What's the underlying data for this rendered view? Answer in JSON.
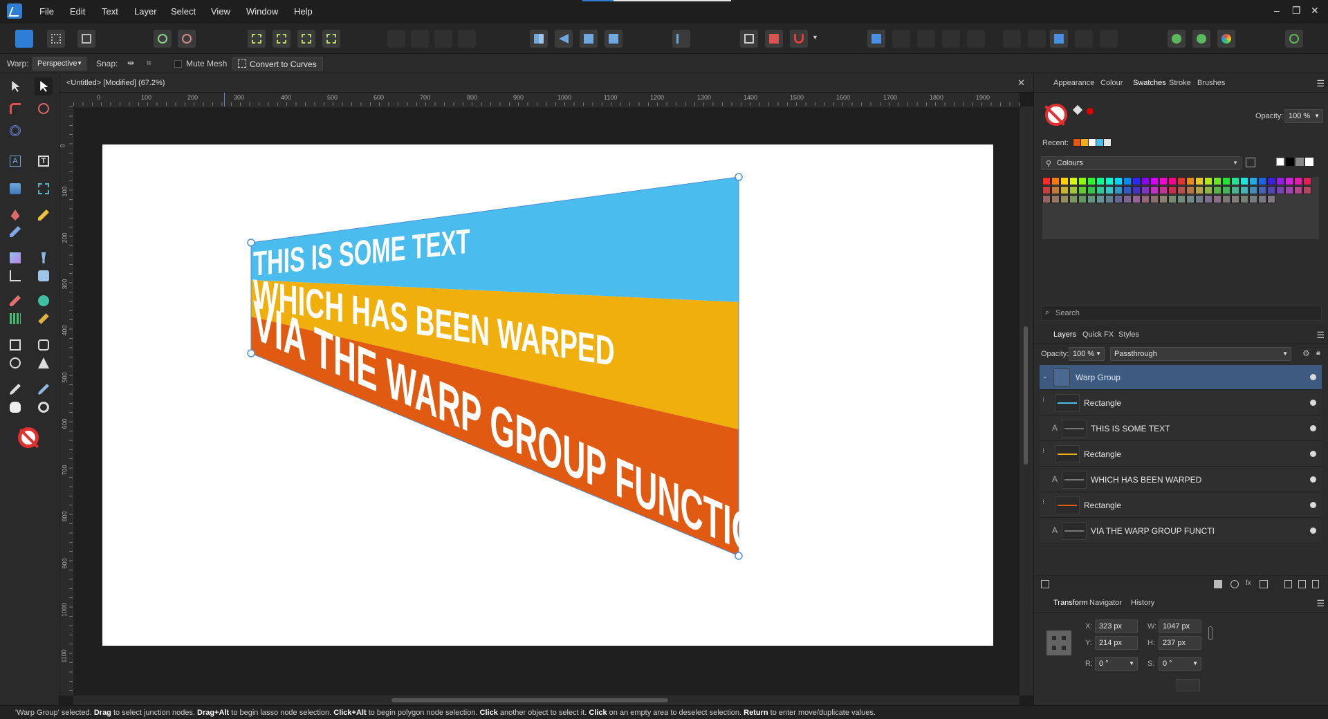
{
  "menubar": {
    "items": [
      "File",
      "Edit",
      "Text",
      "Layer",
      "Select",
      "View",
      "Window",
      "Help"
    ],
    "window_controls": [
      "–",
      "❐",
      "✕"
    ]
  },
  "context_bar": {
    "warp_label": "Warp:",
    "warp_value": "Perspective",
    "snap_label": "Snap:",
    "mute_mesh_label": "Mute Mesh",
    "convert_button": "Convert to Curves"
  },
  "document": {
    "tab_title": "<Untitled> [Modified] (67.2%)",
    "close_glyph": "✕",
    "hruler_ticks": [
      "0",
      "100",
      "200",
      "300",
      "400",
      "500",
      "600",
      "700",
      "800",
      "900",
      "1000",
      "1100",
      "1200",
      "1300",
      "1400",
      "1500",
      "1600",
      "1700",
      "1800",
      "1900"
    ],
    "vruler_ticks": [
      "0",
      "100",
      "200",
      "300",
      "400",
      "500",
      "600",
      "700",
      "800",
      "900",
      "1000",
      "1100"
    ],
    "artwork": {
      "band1_text": "THIS IS SOME TEXT",
      "band2_text": "WHICH HAS BEEN WARPED",
      "band3_text": "VIA THE WARP GROUP FUNCTION",
      "colors": {
        "band1": "#4bbcee",
        "band2": "#f1af0c",
        "band3": "#e05a12",
        "text": "#ffffff",
        "handle": "#4d8fd6"
      }
    }
  },
  "panel_top": {
    "tabs": [
      "Appearance",
      "Colour",
      "Swatches",
      "Stroke",
      "Brushes"
    ],
    "active_tab": "Swatches",
    "opacity_label": "Opacity:",
    "opacity_value": "100 %",
    "recent_label": "Recent:",
    "recent_colors": [
      "#e05a12",
      "#f1af0c",
      "#ffffff",
      "#4bbcee",
      "#e6e6e6"
    ],
    "palette_label": "Colours",
    "palette_colors": [
      "#ff2a2a",
      "#ff7a00",
      "#ffd400",
      "#d6ff00",
      "#8cff00",
      "#2aff2a",
      "#00ff8c",
      "#00ffd6",
      "#00d6ff",
      "#008cff",
      "#2a2aff",
      "#8c00ff",
      "#d600ff",
      "#ff00d6",
      "#ff008c",
      "#e63232",
      "#e68a1e",
      "#e6c81e",
      "#b4e61e",
      "#6ee61e",
      "#1ee632",
      "#1ee696",
      "#1ee6dc",
      "#1eaae6",
      "#1e64e6",
      "#3c1ee6",
      "#961ee6",
      "#dc1ee6",
      "#e61eaa",
      "#e61e5a",
      "#c83c3c",
      "#c87a32",
      "#c8b432",
      "#a0c832",
      "#64c832",
      "#32c846",
      "#32c896",
      "#32c8c8",
      "#3296c8",
      "#325ac8",
      "#4632c8",
      "#8232c8",
      "#c032c8",
      "#c83296",
      "#c83250",
      "#b45050",
      "#b47846",
      "#b4a046",
      "#8cb446",
      "#5ab446",
      "#46b45a",
      "#46b48c",
      "#46b4b4",
      "#468cb4",
      "#4664b4",
      "#5046b4",
      "#7846b4",
      "#a046b4",
      "#b4468c",
      "#b44660",
      "#966464",
      "#967864",
      "#968c64",
      "#7d9664",
      "#649664",
      "#64967d",
      "#649696",
      "#647d96",
      "#646496",
      "#7d6496",
      "#966496",
      "#96647d",
      "#8c7070",
      "#8c8270",
      "#7a8c70",
      "#708c7a",
      "#708a8c",
      "#707a8c",
      "#7a708c",
      "#8c7088",
      "#807878",
      "#808078",
      "#788078",
      "#787e80",
      "#787880",
      "#807880"
    ],
    "search_placeholder": "Search"
  },
  "layers_panel": {
    "tabs": [
      "Layers",
      "Quick FX",
      "Styles"
    ],
    "active_tab": "Layers",
    "opacity_label": "Opacity:",
    "opacity_value": "100 %",
    "blend_mode": "Passthrough",
    "rows": [
      {
        "name": "Warp Group",
        "type": "group"
      },
      {
        "name": "Rectangle",
        "type": "rect",
        "color": "#4bbcee"
      },
      {
        "name": "THIS IS SOME TEXT",
        "type": "text"
      },
      {
        "name": "Rectangle",
        "type": "rect",
        "color": "#f1af0c"
      },
      {
        "name": "WHICH HAS BEEN WARPED",
        "type": "text"
      },
      {
        "name": "Rectangle",
        "type": "rect",
        "color": "#e05a12"
      },
      {
        "name": "VIA THE WARP GROUP FUNCTI",
        "type": "text"
      }
    ]
  },
  "transform_panel": {
    "tabs": [
      "Transform",
      "Navigator",
      "History"
    ],
    "active_tab": "Transform",
    "x_label": "X:",
    "x_value": "323 px",
    "y_label": "Y:",
    "y_value": "214 px",
    "w_label": "W:",
    "w_value": "1047 px",
    "h_label": "H:",
    "h_value": "237 px",
    "r_label": "R:",
    "r_value": "0 °",
    "s_label": "S:",
    "s_value": "0 °"
  },
  "status": {
    "segments": [
      {
        "t": "'Warp Group' selected. ",
        "b": false
      },
      {
        "t": "Drag",
        "b": true
      },
      {
        "t": " to select junction nodes. ",
        "b": false
      },
      {
        "t": "Drag+Alt",
        "b": true
      },
      {
        "t": " to begin lasso node selection. ",
        "b": false
      },
      {
        "t": "Click+Alt",
        "b": true
      },
      {
        "t": " to begin polygon node selection. ",
        "b": false
      },
      {
        "t": "Click",
        "b": true
      },
      {
        "t": " another object to select it. ",
        "b": false
      },
      {
        "t": "Click",
        "b": true
      },
      {
        "t": " on an empty area to deselect selection. ",
        "b": false
      },
      {
        "t": "Return",
        "b": true
      },
      {
        "t": " to enter move/duplicate values.",
        "b": false
      }
    ]
  }
}
